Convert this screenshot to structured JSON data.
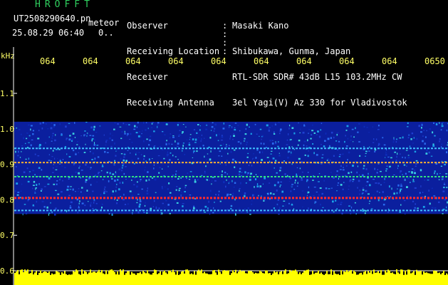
{
  "header": {
    "app_title": "HROFFT",
    "file_name": "UT2508290640.pn",
    "mode": "meteor",
    "date_time": "25.08.29 06:40",
    "count": "0.."
  },
  "info": [
    {
      "label": "Observer",
      "value": "Masaki Kano"
    },
    {
      "label": "Receiving Location",
      "value": "Shibukawa, Gunma, Japan"
    },
    {
      "label": "Receiver",
      "value": "RTL-SDR SDR# 43dB L15 103.2MHz CW"
    },
    {
      "label": "Receiving Antenna",
      "value": "3el Yagi(V) Az 330 for Vladivostok"
    }
  ],
  "axis": {
    "unit": "kHz",
    "y_ticks": [
      "1.1",
      "1.0",
      "0.9",
      "0.8",
      "0.7",
      "0.6"
    ],
    "time_ticks": [
      "064",
      "064",
      "064",
      "064",
      "064",
      "064",
      "064",
      "064",
      "064",
      "0650"
    ]
  },
  "colors": {
    "background": "#000000",
    "axis_text": "#ffff66",
    "app_title": "#2fd05f",
    "noise_band": "#0b1f9e",
    "signal_hot": "#ff2a2a",
    "level_bar": "#ffff00"
  },
  "chart_data": {
    "type": "heatmap",
    "ylabel": "kHz",
    "ylim": [
      0.6,
      1.12
    ],
    "band_range_khz": [
      0.76,
      1.02
    ],
    "carrier_lines_khz": [
      0.945,
      0.905,
      0.865,
      0.805,
      0.77
    ]
  }
}
